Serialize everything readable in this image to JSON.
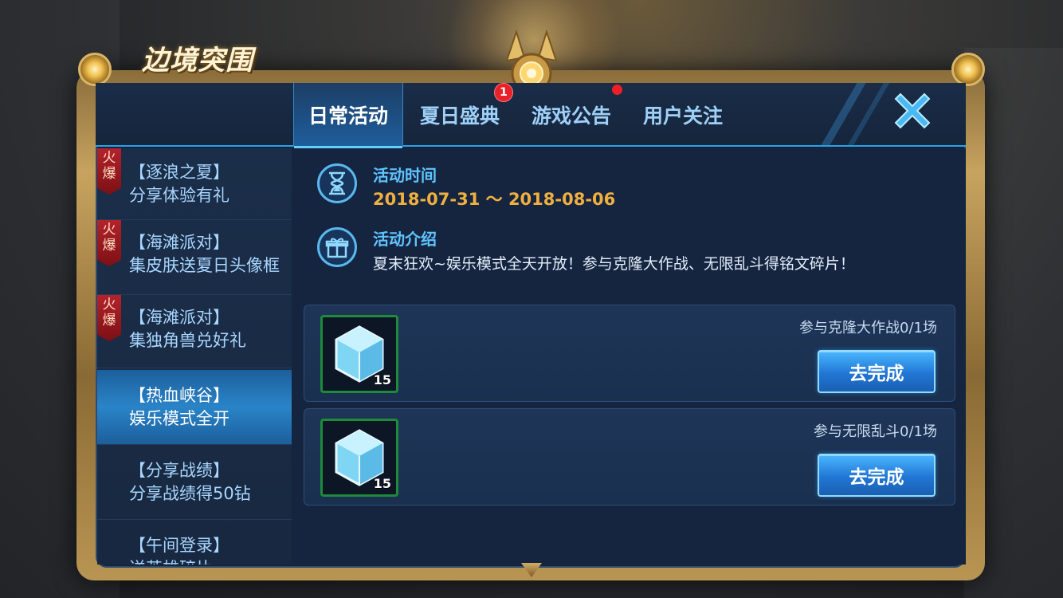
{
  "game_title": "边境突围",
  "tabs": [
    {
      "label": "日常活动",
      "active": true
    },
    {
      "label": "夏日盛典",
      "active": false,
      "badge": "1"
    },
    {
      "label": "游戏公告",
      "active": false,
      "dot": true
    },
    {
      "label": "用户关注",
      "active": false
    }
  ],
  "close_icon": "close-x-icon",
  "sidebar": {
    "items": [
      {
        "title": "【逐浪之夏】",
        "subtitle": "分享体验有礼",
        "hot": true
      },
      {
        "title": "【海滩派对】",
        "subtitle": "集皮肤送夏日头像框",
        "hot": true
      },
      {
        "title": "【海滩派对】",
        "subtitle": "集独角兽兑好礼",
        "hot": true
      },
      {
        "title": "【热血峡谷】",
        "subtitle": "娱乐模式全开",
        "hot": false,
        "active": true
      },
      {
        "title": "【分享战绩】",
        "subtitle": "分享战绩得50钻",
        "hot": false
      },
      {
        "title": "【午间登录】",
        "subtitle": "送英雄碎片",
        "hot": false
      }
    ],
    "hot_tag": "火爆"
  },
  "activity": {
    "time_label": "活动时间",
    "time_value": "2018-07-31 ～ 2018-08-06",
    "intro_label": "活动介绍",
    "intro_text": "夏末狂欢~娱乐模式全天开放！参与克隆大作战、无限乱斗得铭文碎片！"
  },
  "tasks": [
    {
      "reward_icon": "crystal-cube-icon",
      "reward_count": "15",
      "text": "参与克隆大作战0/1场",
      "button": "去完成"
    },
    {
      "reward_icon": "crystal-cube-icon",
      "reward_count": "15",
      "text": "参与无限乱斗0/1场",
      "button": "去完成"
    }
  ],
  "colors": {
    "accent": "#2aa0e8",
    "gold": "#c7a35f",
    "date": "#f0b040",
    "hot": "#b3232b",
    "badge": "#e8202a"
  }
}
